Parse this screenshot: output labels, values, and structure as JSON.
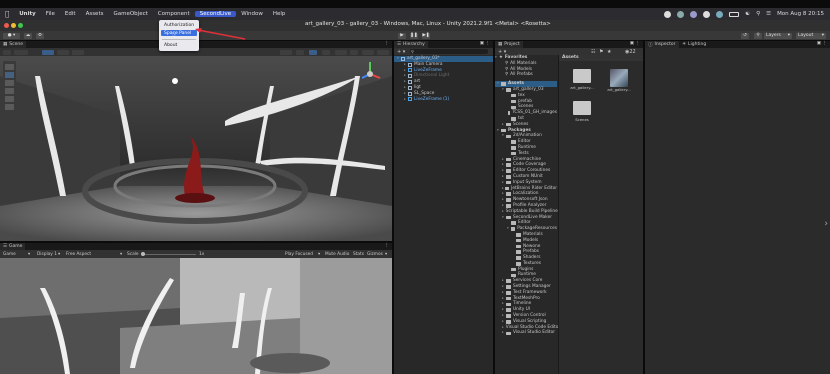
{
  "menubar": {
    "app": "Unity",
    "items": [
      "File",
      "Edit",
      "Assets",
      "GameObject",
      "Component",
      "SecondLive",
      "Window",
      "Help"
    ],
    "clock": "Mon Aug 8  20:15"
  },
  "window": {
    "title": "art_gallery_03 - gallery_03 - Windows, Mac, Linux - Unity 2021.2.9f1 <Metal> <Rosetta>"
  },
  "toolbar": {
    "layers_label": "Layers",
    "layout_label": "Layout"
  },
  "dropdown": {
    "items": [
      "Authorization",
      "Space Panel",
      "About"
    ],
    "highlighted": "Space Panel"
  },
  "scene": {
    "tab_label": "Scene"
  },
  "game": {
    "tab_label": "Game",
    "display_select": "Game",
    "display_num": "Display 1",
    "aspect": "Free Aspect",
    "scale_label": "Scale",
    "scale_value": "1x",
    "play_focused": "Play Focused",
    "mute_audio": "Mute Audio",
    "stats": "Stats",
    "gizmos": "Gizmos"
  },
  "hierarchy": {
    "tab_label": "Hierarchy",
    "items": [
      {
        "label": "art_gallery_03*",
        "depth": 0,
        "kind": "scene"
      },
      {
        "label": "Main Camera",
        "depth": 1,
        "kind": "go"
      },
      {
        "label": "LiveZeFrame",
        "depth": 1,
        "kind": "prefab"
      },
      {
        "label": "Directional Light",
        "depth": 1,
        "kind": "dim"
      },
      {
        "label": "art",
        "depth": 1,
        "kind": "go"
      },
      {
        "label": "ligt",
        "depth": 1,
        "kind": "go"
      },
      {
        "label": "SL_Space",
        "depth": 1,
        "kind": "go"
      },
      {
        "label": "LiveZeFrame (1)",
        "depth": 1,
        "kind": "prefab"
      }
    ]
  },
  "project": {
    "tab_label": "Project",
    "favorites_label": "Favorites",
    "favorites": [
      "All Materials",
      "All Models",
      "All Prefabs"
    ],
    "assets_label": "Assets",
    "tree": [
      {
        "label": "Assets",
        "depth": 0
      },
      {
        "label": "art_gallery_03",
        "depth": 1
      },
      {
        "label": "tex",
        "depth": 2
      },
      {
        "label": "prefab",
        "depth": 2
      },
      {
        "label": "Scenes",
        "depth": 2
      },
      {
        "label": "TCSS_01_GH_images",
        "depth": 2
      },
      {
        "label": "txt",
        "depth": 2
      },
      {
        "label": "Scenes",
        "depth": 1
      },
      {
        "label": "Packages",
        "depth": 0
      },
      {
        "label": "2d/Animation",
        "depth": 1
      },
      {
        "label": "Editor",
        "depth": 2
      },
      {
        "label": "Runtime",
        "depth": 2
      },
      {
        "label": "Tests",
        "depth": 2
      },
      {
        "label": "Cinemachine",
        "depth": 1
      },
      {
        "label": "Code Coverage",
        "depth": 1
      },
      {
        "label": "Editor Coroutines",
        "depth": 1
      },
      {
        "label": "Custom NUnit",
        "depth": 1
      },
      {
        "label": "Input System",
        "depth": 1
      },
      {
        "label": "JetBrains Rider Editor",
        "depth": 1
      },
      {
        "label": "Localization",
        "depth": 1
      },
      {
        "label": "Newtonsoft Json",
        "depth": 1
      },
      {
        "label": "Profile Analyzer",
        "depth": 1
      },
      {
        "label": "Scriptable Build Pipeline",
        "depth": 1
      },
      {
        "label": "SecondLive Maker",
        "depth": 1
      },
      {
        "label": "Editor",
        "depth": 2
      },
      {
        "label": "PackageResources",
        "depth": 2
      },
      {
        "label": "Materials",
        "depth": 3
      },
      {
        "label": "Models",
        "depth": 3
      },
      {
        "label": "Newone",
        "depth": 3
      },
      {
        "label": "Prefabs",
        "depth": 3
      },
      {
        "label": "Shaders",
        "depth": 3
      },
      {
        "label": "Textures",
        "depth": 3
      },
      {
        "label": "Plugins",
        "depth": 2
      },
      {
        "label": "Runtime",
        "depth": 2
      },
      {
        "label": "Services Core",
        "depth": 1
      },
      {
        "label": "Settings Manager",
        "depth": 1
      },
      {
        "label": "Test Framework",
        "depth": 1
      },
      {
        "label": "TextMeshPro",
        "depth": 1
      },
      {
        "label": "Timeline",
        "depth": 1
      },
      {
        "label": "Unity UI",
        "depth": 1
      },
      {
        "label": "Version Control",
        "depth": 1
      },
      {
        "label": "Visual Scripting",
        "depth": 1
      },
      {
        "label": "Visual Studio Code Editor",
        "depth": 1
      },
      {
        "label": "Visual Studio Editor",
        "depth": 1
      }
    ],
    "grid_header": "Assets",
    "grid": [
      "art_gallery...",
      "art_gallery...",
      "Scenes"
    ],
    "slider_value": "22"
  },
  "inspector": {
    "tab_label": "Inspector",
    "lighting_label": "Lighting"
  },
  "colors": {
    "accent": "#3a6fdf",
    "menubar_highlight": "#3a59c8",
    "arrow": "#e0303a"
  }
}
